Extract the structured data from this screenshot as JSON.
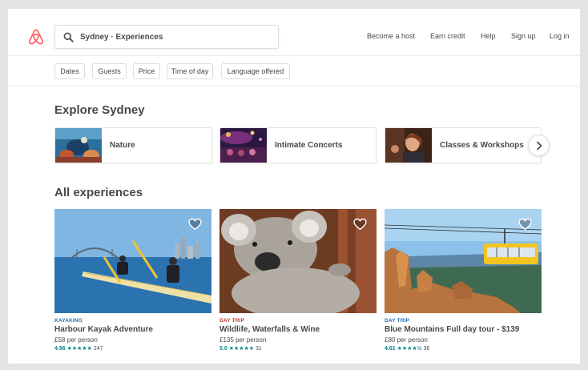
{
  "brand": {
    "accent": "#ff5a5f",
    "teal": "#008489"
  },
  "header": {
    "search_value": "Sydney · Experiences",
    "nav": [
      "Become a host",
      "Earn credit",
      "Help",
      "Sign up",
      "Log in"
    ]
  },
  "filters": [
    "Dates",
    "Guests",
    "Price",
    "Time of day",
    "Language offered"
  ],
  "explore": {
    "title": "Explore Sydney",
    "categories": [
      "Nature",
      "Intimate Concerts",
      "Classes & Workshops"
    ]
  },
  "experiences": {
    "title": "All experiences",
    "items": [
      {
        "kind": "KAYAKING",
        "kind_color": "#1f6fb2",
        "title": "Harbour Kayak Adventure",
        "price": "£58 per person",
        "score": "4.96",
        "stars": "★★★★★",
        "reviews": "247"
      },
      {
        "kind": "DAY TRIP",
        "kind_color": "#c0392b",
        "title": "Wildlife, Waterfalls & Wine",
        "price": "£135 per person",
        "score": "5.0",
        "stars": "★★★★★",
        "reviews": "31"
      },
      {
        "kind": "DAY TRIP",
        "kind_color": "#1f6fb2",
        "title": "Blue Mountains Full day tour - $139",
        "price": "£80 per person",
        "score": "4.61",
        "stars": "★★★★½",
        "reviews": "36"
      }
    ]
  }
}
